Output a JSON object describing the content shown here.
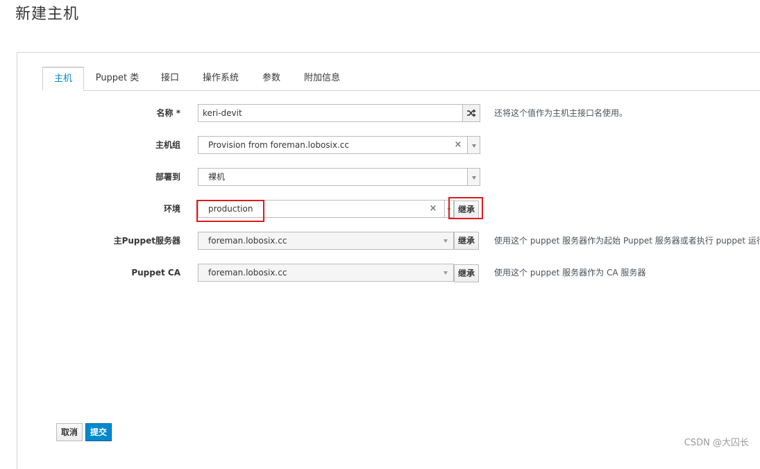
{
  "page": {
    "title": "新建主机"
  },
  "tabs": [
    {
      "label": "主机",
      "active": true
    },
    {
      "label": "Puppet 类"
    },
    {
      "label": "接口"
    },
    {
      "label": "操作系统"
    },
    {
      "label": "参数"
    },
    {
      "label": "附加信息"
    }
  ],
  "form": {
    "name": {
      "label": "名称",
      "required_mark": "*",
      "value": "keri-devit",
      "help": "还将这个值作为主机主接口名使用。",
      "icon": "shuffle-icon"
    },
    "hostgroup": {
      "label": "主机组",
      "value": "Provision from foreman.lobosix.cc",
      "clear": "×"
    },
    "deploy": {
      "label": "部署到",
      "value": "裸机"
    },
    "environment": {
      "label": "环境",
      "value": "production",
      "clear": "×",
      "inherit_label": "继承"
    },
    "puppet_master": {
      "label": "主Puppet服务器",
      "value": "foreman.lobosix.cc",
      "inherit_label": "继承",
      "help": "使用这个 puppet 服务器作为起始 Puppet 服务器或者执行 puppet 运行"
    },
    "puppet_ca": {
      "label": "Puppet CA",
      "value": "foreman.lobosix.cc",
      "inherit_label": "继承",
      "help": "使用这个 puppet 服务器作为 CA 服务器"
    }
  },
  "actions": {
    "cancel": "取消",
    "submit": "提交"
  },
  "watermark": "CSDN @大囚长",
  "colors": {
    "accent": "#0088ce",
    "highlight": "#e0191b"
  }
}
